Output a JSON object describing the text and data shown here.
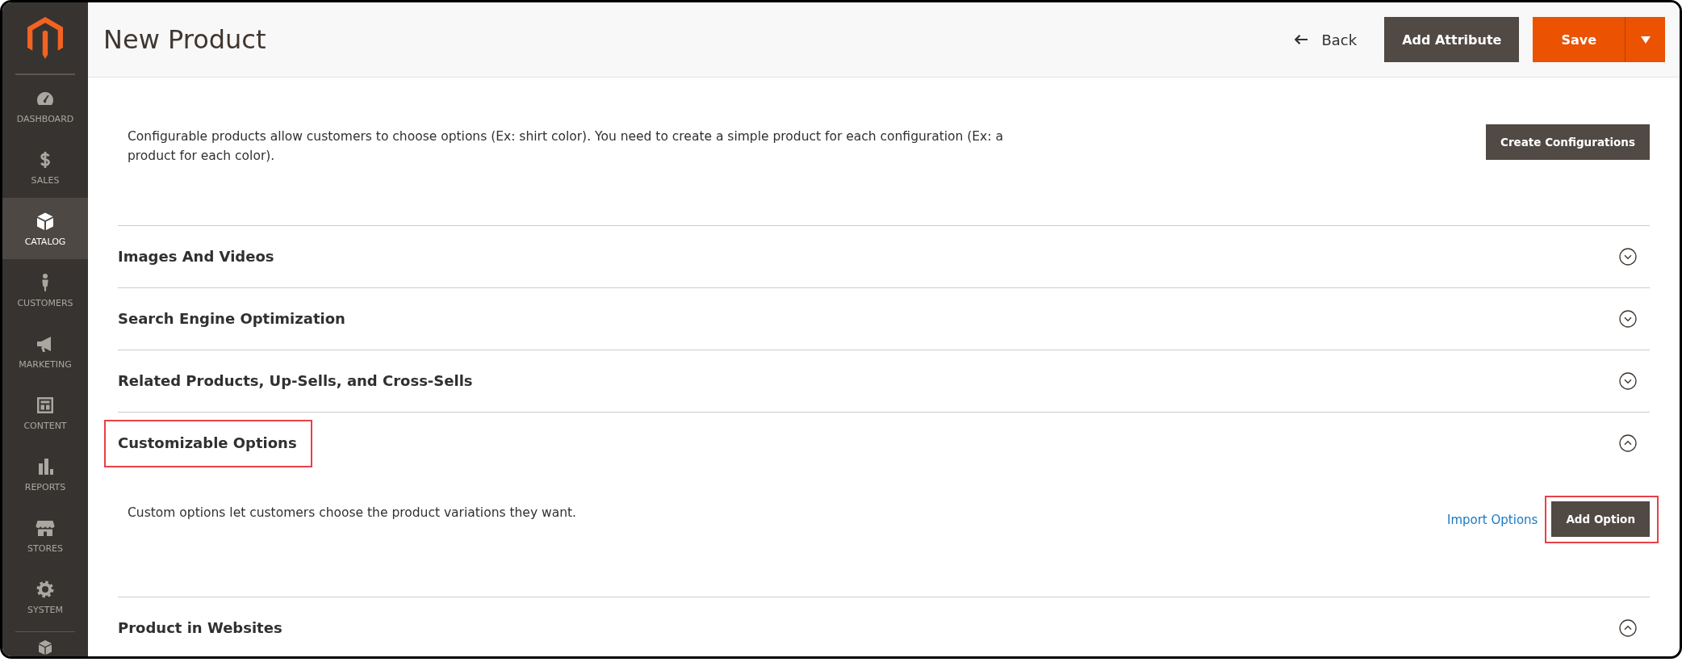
{
  "sidebar": {
    "items": [
      {
        "label": "DASHBOARD",
        "selected": false
      },
      {
        "label": "SALES",
        "selected": false
      },
      {
        "label": "CATALOG",
        "selected": true
      },
      {
        "label": "CUSTOMERS",
        "selected": false
      },
      {
        "label": "MARKETING",
        "selected": false
      },
      {
        "label": "CONTENT",
        "selected": false
      },
      {
        "label": "REPORTS",
        "selected": false
      },
      {
        "label": "STORES",
        "selected": false
      },
      {
        "label": "SYSTEM",
        "selected": false
      }
    ]
  },
  "header": {
    "title": "New Product",
    "back": "Back",
    "add_attribute": "Add Attribute",
    "save": "Save"
  },
  "notice": {
    "text": "Configurable products allow customers to choose options (Ex: shirt color). You need to create a simple product for each configuration (Ex: a product for each color).",
    "button": "Create Configurations"
  },
  "sections": [
    {
      "title": "Images And Videos",
      "expanded": false,
      "highlighted": false
    },
    {
      "title": "Search Engine Optimization",
      "expanded": false,
      "highlighted": false
    },
    {
      "title": "Related Products, Up-Sells, and Cross-Sells",
      "expanded": false,
      "highlighted": false
    },
    {
      "title": "Customizable Options",
      "expanded": true,
      "highlighted": true,
      "content": {
        "text": "Custom options let customers choose the product variations they want.",
        "link": "Import Options",
        "button": "Add Option",
        "button_highlighted": true
      }
    },
    {
      "title": "Product in Websites",
      "expanded": true,
      "highlighted": false
    }
  ]
}
